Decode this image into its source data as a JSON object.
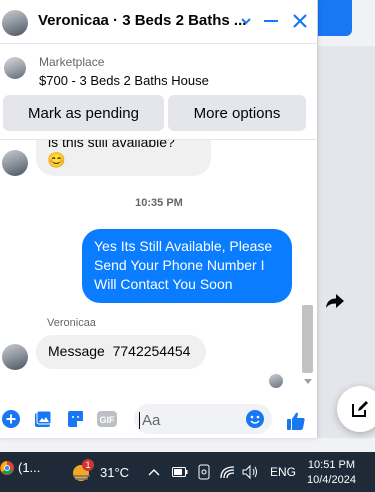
{
  "window": {
    "title": "Veronicaa · 3 Beds 2 Baths ...",
    "icons": {
      "chevron": "chevron-down-icon",
      "minimize": "minimize-icon",
      "close": "close-icon"
    }
  },
  "listing": {
    "category": "Marketplace",
    "title": "$700 - 3 Beds 2 Baths House"
  },
  "actions": {
    "pending_label": "Mark as pending",
    "more_label": "More options"
  },
  "messages": {
    "previous_text": "is this still available?",
    "previous_emoji": "😊",
    "timestamp": "10:35 PM",
    "outgoing": "Yes Its Still Available, Please Send Your Phone Number I Will Contact You Soon",
    "sender": "Veronicaa",
    "incoming": "Message  7742254454"
  },
  "composer": {
    "placeholder": "Aa",
    "icons": [
      "plus-icon",
      "photo-icon",
      "sticker-icon",
      "gif-icon",
      "emoji-icon",
      "like-icon"
    ]
  },
  "taskbar": {
    "app_label": "(1...",
    "weather_badge": "1",
    "temperature": "31°C",
    "language": "ENG",
    "time": "10:51 PM",
    "date": "10/4/2024"
  },
  "colors": {
    "accent": "#1877f2",
    "outgoing_bubble": "#0a7cff",
    "incoming_bubble": "#f0f0f0",
    "taskbar": "#1f2a38"
  }
}
